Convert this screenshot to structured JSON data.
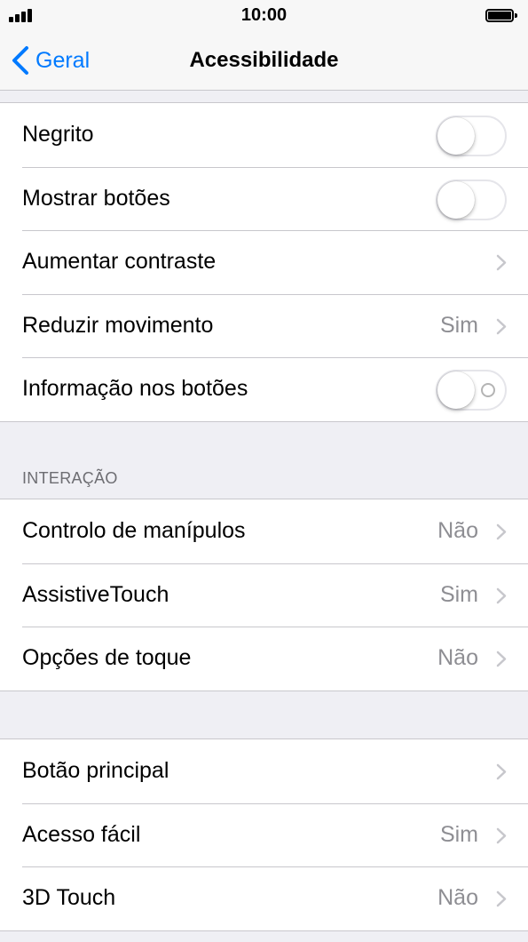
{
  "status_bar": {
    "time": "10:00"
  },
  "nav": {
    "back_label": "Geral",
    "title": "Acessibilidade"
  },
  "group1": {
    "rows": [
      {
        "label": "Negrito",
        "control": "toggle",
        "on": false
      },
      {
        "label": "Mostrar botões",
        "control": "toggle",
        "on": false
      },
      {
        "label": "Aumentar contraste",
        "control": "chevron"
      },
      {
        "label": "Reduzir movimento",
        "value": "Sim",
        "control": "chevron"
      },
      {
        "label": "Informação nos botões",
        "control": "toggle",
        "on": false
      }
    ]
  },
  "interaction": {
    "header": "INTERAÇÃO",
    "rows": [
      {
        "label": "Controlo de manípulos",
        "value": "Não"
      },
      {
        "label": "AssistiveTouch",
        "value": "Sim"
      },
      {
        "label": "Opções de toque",
        "value": "Não"
      }
    ]
  },
  "group3": {
    "rows": [
      {
        "label": "Botão principal"
      },
      {
        "label": "Acesso fácil",
        "value": "Sim"
      },
      {
        "label": "3D Touch",
        "value": "Não"
      }
    ]
  },
  "colors": {
    "accent": "#007aff",
    "background": "#efeff4",
    "secondary_text": "#8e8e93",
    "separator": "#c8c7cc"
  }
}
